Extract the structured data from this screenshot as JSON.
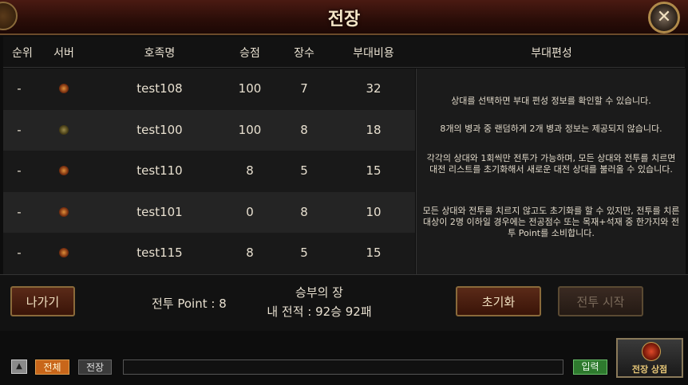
{
  "window": {
    "title": "전장",
    "close_icon": "close-icon"
  },
  "table": {
    "headers": {
      "rank": "순위",
      "server": "서버",
      "name": "호족명",
      "points": "승점",
      "generals": "장수",
      "cost": "부대비용",
      "formation": "부대편성"
    },
    "rows": [
      {
        "rank": "-",
        "server_icon": "server-emblem-icon",
        "name": "test108",
        "points": "100",
        "generals": "7",
        "cost": "32"
      },
      {
        "rank": "-",
        "server_icon": "server-emblem-icon",
        "name": "test100",
        "points": "100",
        "generals": "8",
        "cost": "18"
      },
      {
        "rank": "-",
        "server_icon": "server-emblem-icon",
        "name": "test110",
        "points": "8",
        "generals": "5",
        "cost": "15"
      },
      {
        "rank": "-",
        "server_icon": "server-emblem-icon",
        "name": "test101",
        "points": "0",
        "generals": "8",
        "cost": "10"
      },
      {
        "rank": "-",
        "server_icon": "server-emblem-icon",
        "name": "test115",
        "points": "8",
        "generals": "5",
        "cost": "15"
      }
    ]
  },
  "info": {
    "line1": "상대를 선택하면 부대 편성 정보를 확인할 수 있습니다.",
    "line2": "8개의 병과 중 랜덤하게 2개 병과 정보는 제공되지 않습니다.",
    "line3": "각각의 상대와 1회씩만 전투가 가능하며, 모든 상대와 전투를 치르면 대전 리스트를 초기화해서 새로운 대전 상대를 불러올 수 있습니다.",
    "line4": "모든 상대와 전투를 치르지 않고도 초기화를 할 수 있지만, 전투를 치른 대상이 2명 이하일 경우에는 전공점수 또는 목재+석재 중 한가지와 전투 Point를 소비합니다."
  },
  "actions": {
    "exit_label": "나가기",
    "battle_points": "전투 Point : 8",
    "result_title": "승부의 장",
    "record": "내 전적 : 92승 92패",
    "reset_label": "초기화",
    "start_label": "전투 시작"
  },
  "chat": {
    "toggle_icon": "triangle-up-icon",
    "channel_all": "전체",
    "channel_battlefield": "전장",
    "input_value": "",
    "enter_label": "입력",
    "shop_label": "전장 상점",
    "shop_icon": "shop-emblem-icon"
  },
  "colors": {
    "accent": "#c8661a",
    "enter_green": "#2e7a2e",
    "frame_gold": "#8a6a3a"
  }
}
